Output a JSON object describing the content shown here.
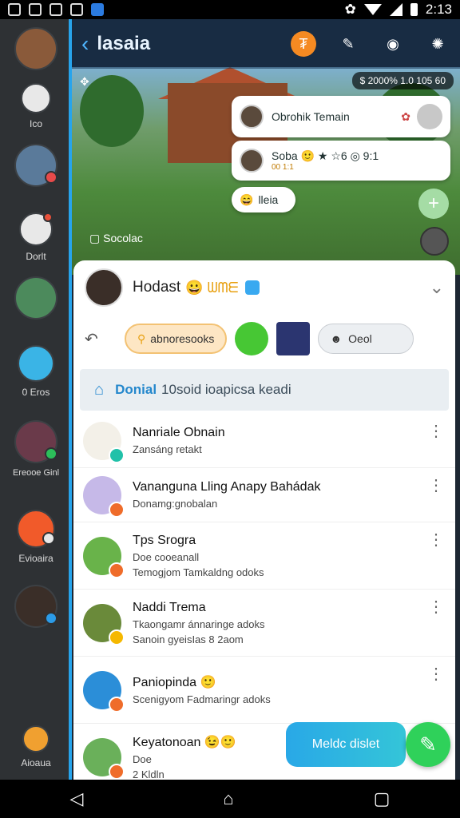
{
  "status": {
    "time": "2:13"
  },
  "rail": {
    "items": [
      {
        "label": "",
        "color": "#8a5a3a",
        "badge": ""
      },
      {
        "label": "Ico",
        "color": "#e8e8e8",
        "badge": ""
      },
      {
        "label": "",
        "color": "#5a7a9a",
        "badge": "#e84a4a"
      },
      {
        "label": "Dorlt",
        "color": "#e8e8e8",
        "badge": "#e8503a"
      },
      {
        "label": "",
        "color": "#4c8a5c",
        "badge": ""
      },
      {
        "label": "0 Eros",
        "color": "#3ab4e6",
        "badge": ""
      },
      {
        "label": "Ereooe Ginl",
        "color": "#6a3a4a",
        "badge": "#2cbf5a"
      },
      {
        "label": "Evioaira",
        "color": "#f15a2a",
        "badge": "#e8e8e8"
      },
      {
        "label": "",
        "color": "#3a2e28",
        "badge": "#2b9be8"
      },
      {
        "label": "Aioaua",
        "color": "#f0a030",
        "badge": "#e84a6a"
      }
    ]
  },
  "topbar": {
    "title": "lasaia"
  },
  "game": {
    "coins": "$ 2000% 1.0 105 60",
    "bubble1": "Obrohik Temain",
    "bubble2": "Soba 🙂 ★ ☆6 ◎ 9:1",
    "bubble2_sub": "00 1:1",
    "bubble3": "lleia",
    "soc_label": "Socolac"
  },
  "sheet": {
    "name": "Hodast",
    "emoji": "😀 ᗯᗰᗴ",
    "chip1": "abnoresooks",
    "chip2": "Oeol",
    "banner_strong": "Donial",
    "banner_text": "10soid ioapicsa keadi",
    "rows": [
      {
        "name": "Nanriale Obnain",
        "sub": "Zansáng retakt",
        "sub2": "",
        "color": "#f3f0e8",
        "badge": "#21c1a9"
      },
      {
        "name": "Vanangunа Lling Anapy Bahádak",
        "sub": "Donamg:gnobalan",
        "sub2": "",
        "color": "#c6b9e8",
        "badge": "#ef6c2a"
      },
      {
        "name": "Tps Srogra",
        "sub": "Doe cooeanall",
        "sub2": "Temogjom Tamkaldng odoks",
        "color": "#69b34a",
        "badge": "#ef6c2a"
      },
      {
        "name": "Naddi Trema",
        "sub": "Tkaongamr ánnaringe adoks",
        "sub2": "Sanoin gyeisIas    8 2aom",
        "color": "#6a8a3a",
        "badge": "#f5b800"
      },
      {
        "name": "Paniopinda 🙂",
        "sub": "Scenigyom Fadmaringr adoks",
        "sub2": "",
        "color": "#2b8ed8",
        "badge": "#ef6c2a"
      },
      {
        "name": "Keyatonoan 😉🙂",
        "sub": "Doe",
        "sub2": "2  Kldln",
        "color": "#6ab05a",
        "badge": "#ef6c2a"
      }
    ]
  },
  "new_button": "Meldc dislet"
}
